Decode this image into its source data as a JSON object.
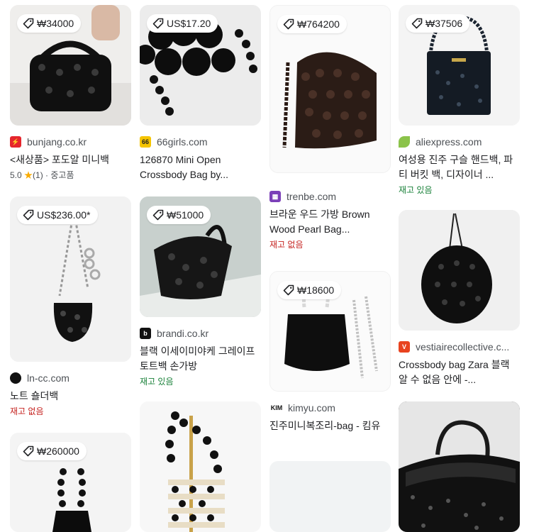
{
  "cards": [
    {
      "price": "₩34000",
      "source": "bunjang.co.kr",
      "title": "<새상품> 포도알 미니백",
      "rating": "5.0",
      "star": "★",
      "reviews": "(1)",
      "sep": " · ",
      "condition": "중고품"
    },
    {
      "price": "US$17.20",
      "source": "66girls.com",
      "title": "126870 Mini Open Crossbody Bag by..."
    },
    {
      "price": "₩764200",
      "source": "trenbe.com",
      "title": "브라운 우드 가방 Brown Wood Pearl Bag...",
      "status": "재고 없음"
    },
    {
      "price": "₩37506",
      "source": "aliexpress.com",
      "title": "여성용 진주 구슬 핸드백, 파티 버킷 백, 디자이너 ...",
      "status": "재고 있음"
    },
    {
      "price": "US$236.00*",
      "source": "ln-cc.com",
      "title": "노트 숄더백",
      "status": "재고 없음"
    },
    {
      "price": "₩51000",
      "source": "brandi.co.kr",
      "title": "블랙 이세이미야케 그레이프 토트백 손가방",
      "status": "재고 있음"
    },
    {
      "price": "₩18600",
      "source": "kimyu.com",
      "title": "진주미니복조리-bag - 킴유",
      "favicon_text": "KIM"
    },
    {
      "source": "vestiairecollective.c...",
      "title": "Crossbody bag Zara 블랙 알 수 없음 안에 -..."
    },
    {
      "price": "₩260000"
    }
  ],
  "colors": {
    "bunjang": "#e5262d",
    "girls66": "#f5c400",
    "trenbe": "#7b3fb8",
    "aliexpress": "#8bc34a",
    "lncc": "#111111",
    "brandi": "#111111",
    "vestiaire": "#e8431f",
    "green": "#188038",
    "red": "#c5221f"
  },
  "icons": [
    "tag-icon",
    "bunjang-favicon",
    "66girls-favicon",
    "trenbe-favicon",
    "aliexpress-favicon",
    "lncc-favicon",
    "brandi-favicon",
    "kimyu-favicon",
    "vestiaire-favicon"
  ]
}
